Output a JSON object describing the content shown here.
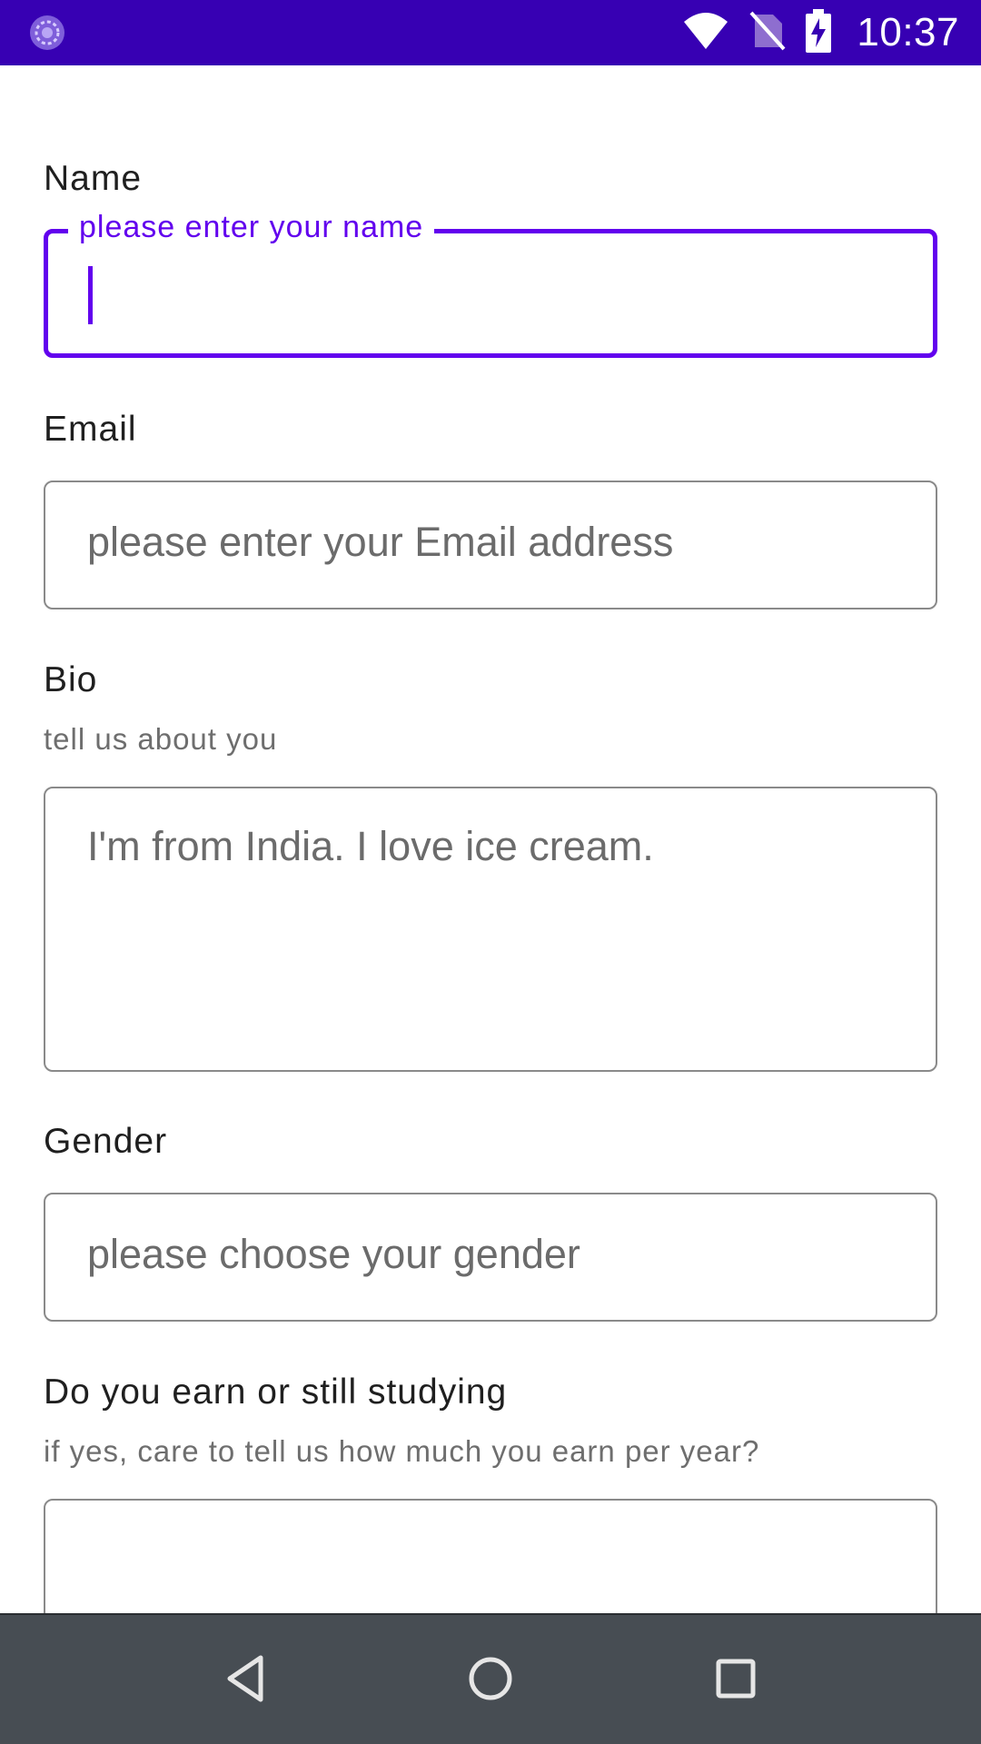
{
  "status_bar": {
    "time": "10:37",
    "app_icon": "app-notification-icon",
    "icons": [
      "wifi-icon",
      "no-sim-icon",
      "battery-charging-icon"
    ],
    "background_color": "#3700b3"
  },
  "form": {
    "accent_color": "#6200ee",
    "name": {
      "label": "Name",
      "floating_label": "please enter your name",
      "value": "",
      "focused": true
    },
    "email": {
      "label": "Email",
      "placeholder": "please enter your Email address"
    },
    "bio": {
      "label": "Bio",
      "helper": "tell us about you",
      "placeholder": "I'm from India. I love ice cream."
    },
    "gender": {
      "label": "Gender",
      "placeholder": "please choose your gender"
    },
    "income": {
      "label": "Do you earn or still studying",
      "helper": "if yes, care to tell us how much you earn per year?",
      "value": ""
    }
  },
  "nav_bar": {
    "icons": [
      "back-icon",
      "home-icon",
      "recents-icon"
    ]
  }
}
